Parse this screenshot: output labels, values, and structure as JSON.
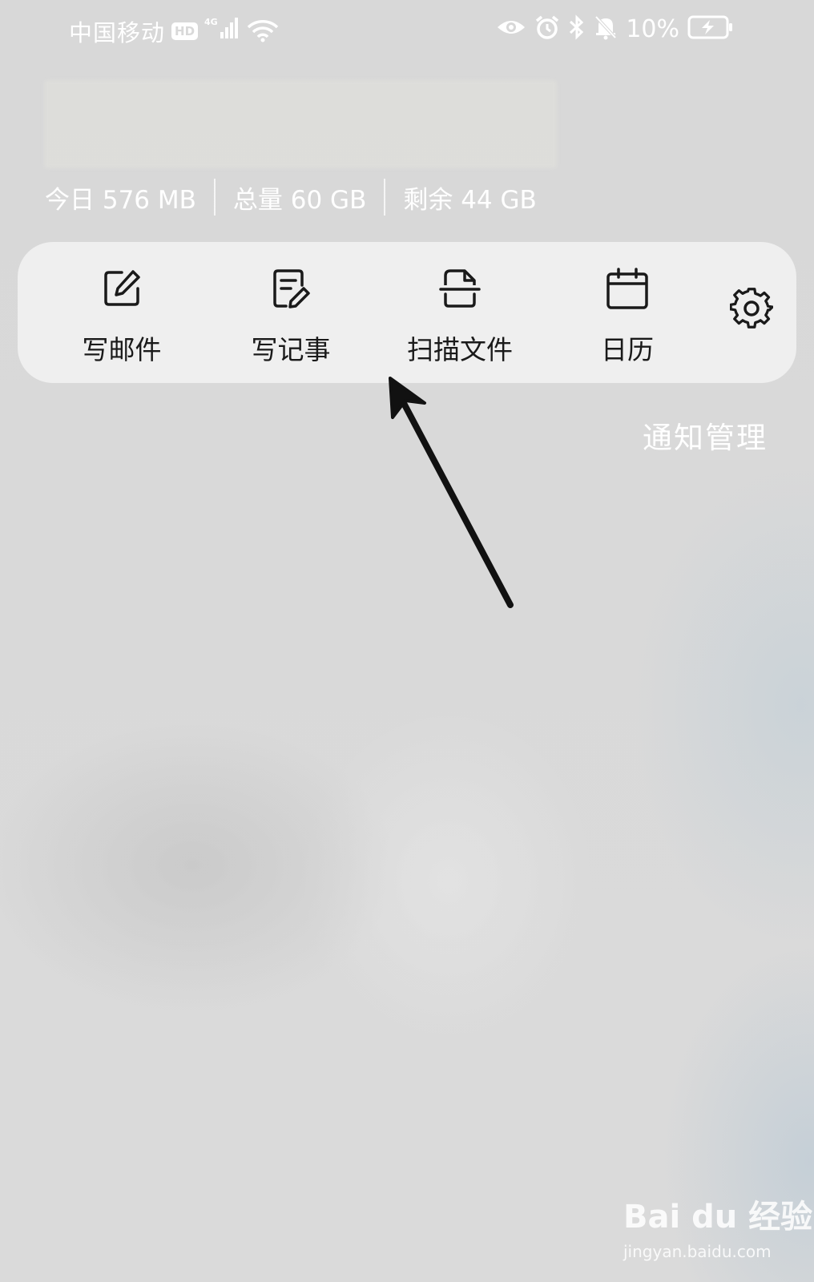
{
  "status_bar": {
    "carrier": "中国移动",
    "hd_badge": "HD",
    "network": "4G",
    "battery_percent": "10%",
    "icons": [
      "eye-icon",
      "alarm-icon",
      "bluetooth-icon",
      "bell-muted-icon",
      "battery-charging-icon"
    ]
  },
  "storage": {
    "today": "今日 576 MB",
    "total": "总量 60 GB",
    "remaining": "剩余 44 GB"
  },
  "shortcuts": [
    {
      "label": "写邮件",
      "icon": "compose-mail-icon"
    },
    {
      "label": "写记事",
      "icon": "write-note-icon"
    },
    {
      "label": "扫描文件",
      "icon": "scan-document-icon"
    },
    {
      "label": "日历",
      "icon": "calendar-icon"
    }
  ],
  "settings_icon": "gear-icon",
  "notification_manage": "通知管理",
  "watermark": {
    "logo": "Bai du 经验",
    "url": "jingyan.baidu.com"
  },
  "colors": {
    "background": "#d9d9d9",
    "panel": "#efefef",
    "text_dark": "#1a1a1a",
    "text_light": "#ffffff",
    "arrow": "#111111"
  }
}
